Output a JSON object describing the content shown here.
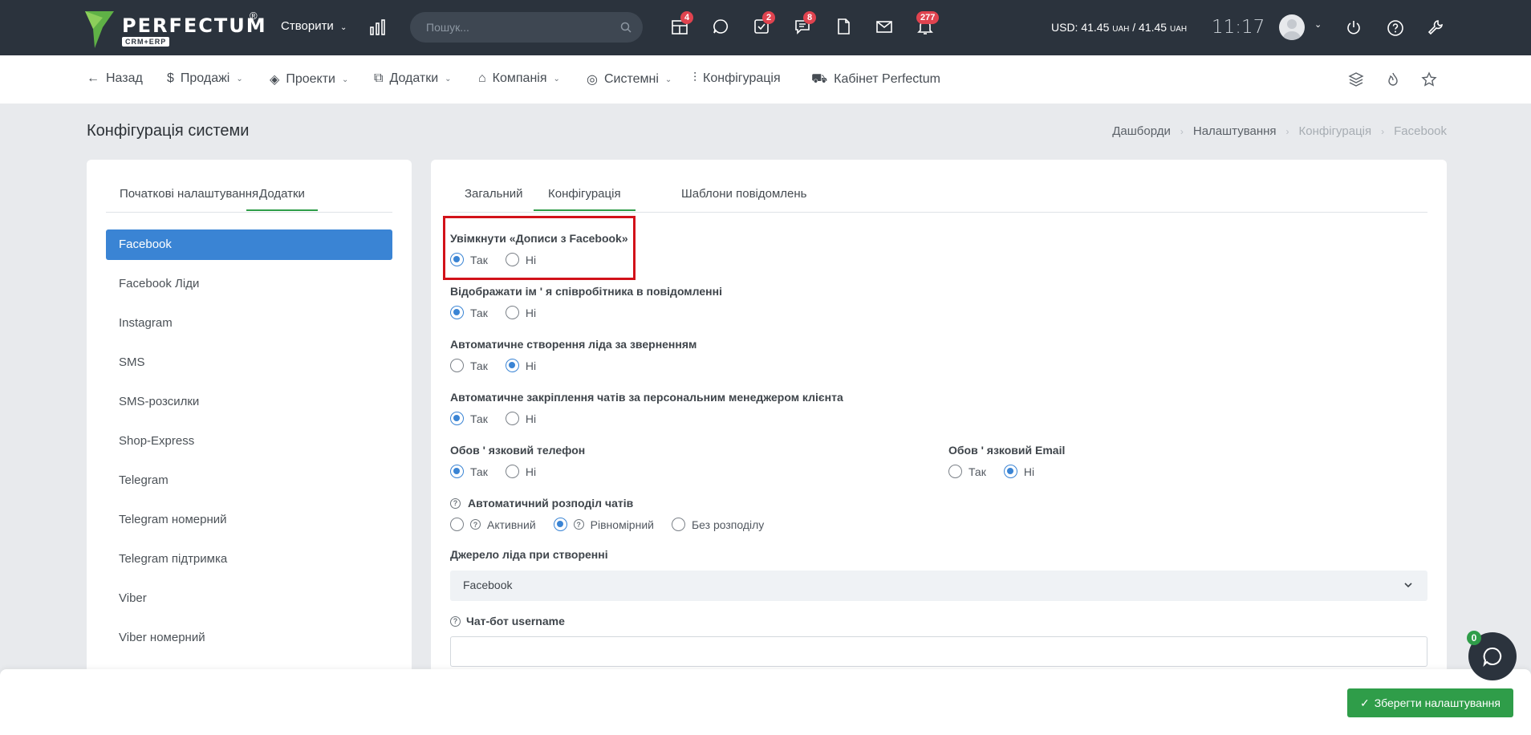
{
  "topbar": {
    "logo_word": "PERFECTUM",
    "logo_reg": "®",
    "logo_sub": "CRM+ERP",
    "create_label": "Створити",
    "search_placeholder": "Пошук...",
    "badges": {
      "projects": "4",
      "tasks": "2",
      "chats": "8",
      "notifications": "277"
    },
    "currency_prefix": "USD: 41.45 ",
    "currency_unit1": "UAH",
    "currency_mid": " / 41.45 ",
    "currency_unit2": "UAH",
    "time": "11:17"
  },
  "nav": {
    "back": "Назад",
    "sales": "Продажі",
    "projects": "Проекти",
    "addons": "Додатки",
    "company": "Компанія",
    "system": "Системні",
    "config": "Конфігурація",
    "cabinet": "Кабінет Perfectum"
  },
  "page": {
    "title": "Конфігурація системи",
    "breadcrumb": [
      "Дашборди",
      "Налаштування",
      "Конфігурація",
      "Facebook"
    ]
  },
  "left": {
    "tabs": [
      "Початкові налаштування",
      "Додатки"
    ],
    "items": [
      "Facebook",
      "Facebook Ліди",
      "Instagram",
      "SMS",
      "SMS-розсилки",
      "Shop-Express",
      "Telegram",
      "Telegram номерний",
      "Telegram підтримка",
      "Viber",
      "Viber номерний"
    ]
  },
  "right": {
    "tabs": [
      "Загальний",
      "Конфігурація",
      "Шаблони повідомлень"
    ],
    "fields": {
      "f1": "Увімкнути «Дописи з Facebook»",
      "f2": "Відображати ім ' я співробітника в повідомленні",
      "f3": "Автоматичне створення ліда за зверненням",
      "f4": "Автоматичне закріплення чатів за персональним менеджером клієнта",
      "f5": "Обов ' язковий телефон",
      "f6": "Обов ' язковий Email",
      "f7": "Автоматичний розподіл чатів",
      "f8": "Джерело ліда при створенні",
      "f9": "Чат-бот username"
    },
    "yes": "Так",
    "no": "Ні",
    "dist_options": [
      "Активний",
      "Рівномірний",
      "Без розподілу"
    ],
    "lead_source_value": "Facebook"
  },
  "footer": {
    "save": "Зберегти налаштування",
    "chat_badge": "0"
  },
  "colors": {
    "accent": "#3a84d4",
    "success": "#2f9d49",
    "highlight": "#d2121a",
    "topbar": "#2b333d"
  }
}
